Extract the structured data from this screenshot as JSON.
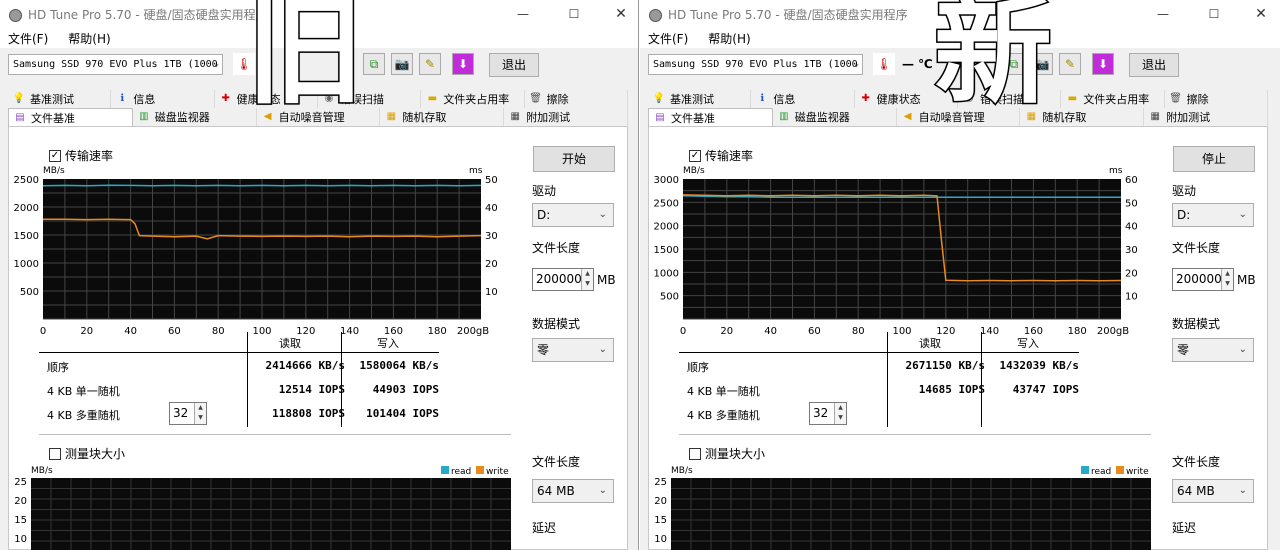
{
  "overlay": {
    "left_char": "旧",
    "right_char": "新"
  },
  "windows": [
    {
      "id": "left",
      "title": "HD Tune Pro 5.70 - 硬盘/固态硬盘实用程序",
      "menu": {
        "file": "文件(F)",
        "help": "帮助(H)"
      },
      "drive": "Samsung SSD 970 EVO Plus 1TB (1000",
      "exit_label": "退出",
      "temp_text": "",
      "tabs_row1": [
        "基准测试",
        "信息",
        "健康状态",
        "错误扫描",
        "文件夹占用率",
        "擦除"
      ],
      "tabs_row2": [
        "文件基准",
        "磁盘监视器",
        "自动噪音管理",
        "随机存取",
        "附加测试"
      ],
      "active_tab": "文件基准",
      "transfer_checkbox": "传输速率",
      "start_button": "开始",
      "drive_label": "驱动",
      "drive_value": "D:",
      "file_length_label": "文件长度",
      "file_length_value": "200000",
      "file_length_unit": "MB",
      "data_mode_label": "数据模式",
      "data_mode_value": "零",
      "results": {
        "read_header": "读取",
        "write_header": "写入",
        "seq_label": "顺序",
        "seq_read": "2414666 KB/s",
        "seq_write": "1580064 KB/s",
        "rand1_label": "4 KB 单一随机",
        "rand1_read": "12514 IOPS",
        "rand1_write": "44903 IOPS",
        "randm_label": "4 KB 多重随机",
        "randm_read": "118808 IOPS",
        "randm_write": "101404 IOPS",
        "queue_depth": "32"
      },
      "block_checkbox": "测量块大小",
      "block_file_length_label": "文件长度",
      "block_file_length_value": "64 MB",
      "latency_label": "延迟",
      "block_chart": {
        "ylabel": "MB/s",
        "ticks": [
          "25",
          "20",
          "15",
          "10"
        ],
        "legend_read": "read",
        "legend_write": "write"
      },
      "chart_data": {
        "type": "line",
        "ylabel_left": "MB/s",
        "ylabel_right": "ms",
        "ylim_left": [
          0,
          2500
        ],
        "yticks_left": [
          "2500",
          "2000",
          "1500",
          "1000",
          "500"
        ],
        "ylim_right": [
          0,
          50
        ],
        "yticks_right": [
          "50",
          "40",
          "30",
          "20",
          "10"
        ],
        "xlim": [
          0,
          200
        ],
        "xticks": [
          "0",
          "20",
          "40",
          "60",
          "80",
          "100",
          "120",
          "140",
          "160",
          "180",
          "200gB"
        ],
        "series": [
          {
            "color": "#2aa8c8",
            "x": [
              0,
              10,
              20,
              30,
              40,
              50,
              60,
              70,
              80,
              90,
              100,
              110,
              120,
              130,
              140,
              150,
              160,
              170,
              180,
              190,
              200
            ],
            "y": [
              2380,
              2385,
              2380,
              2390,
              2385,
              2380,
              2385,
              2380,
              2385,
              2380,
              2385,
              2380,
              2385,
              2380,
              2385,
              2380,
              2385,
              2380,
              2385,
              2380,
              2385
            ]
          },
          {
            "color": "#e88a1e",
            "x": [
              0,
              10,
              20,
              30,
              40,
              42,
              44,
              50,
              60,
              70,
              75,
              80,
              90,
              100,
              110,
              120,
              130,
              140,
              150,
              160,
              170,
              180,
              190,
              200
            ],
            "y": [
              1780,
              1780,
              1775,
              1780,
              1775,
              1700,
              1490,
              1480,
              1470,
              1480,
              1430,
              1490,
              1480,
              1475,
              1480,
              1475,
              1480,
              1470,
              1480,
              1475,
              1480,
              1470,
              1480,
              1490
            ]
          }
        ]
      }
    },
    {
      "id": "right",
      "title": "HD Tune Pro 5.70 - 硬盘/固态硬盘实用程序",
      "menu": {
        "file": "文件(F)",
        "help": "帮助(H)"
      },
      "drive": "Samsung SSD 970 EVO Plus 1TB (1000",
      "exit_label": "退出",
      "temp_text": "— ℃",
      "tabs_row1": [
        "基准测试",
        "信息",
        "健康状态",
        "错误扫描",
        "文件夹占用率",
        "擦除"
      ],
      "tabs_row2": [
        "文件基准",
        "磁盘监视器",
        "自动噪音管理",
        "随机存取",
        "附加测试"
      ],
      "active_tab": "文件基准",
      "transfer_checkbox": "传输速率",
      "start_button": "停止",
      "drive_label": "驱动",
      "drive_value": "D:",
      "file_length_label": "文件长度",
      "file_length_value": "200000",
      "file_length_unit": "MB",
      "data_mode_label": "数据模式",
      "data_mode_value": "零",
      "results": {
        "read_header": "读取",
        "write_header": "写入",
        "seq_label": "顺序",
        "seq_read": "2671150 KB/s",
        "seq_write": "1432039 KB/s",
        "rand1_label": "4 KB 单一随机",
        "rand1_read": "14685 IOPS",
        "rand1_write": "43747 IOPS",
        "randm_label": "4 KB 多重随机",
        "randm_read": "",
        "randm_write": "",
        "queue_depth": "32"
      },
      "block_checkbox": "测量块大小",
      "block_file_length_label": "文件长度",
      "block_file_length_value": "64 MB",
      "latency_label": "延迟",
      "block_chart": {
        "ylabel": "MB/s",
        "ticks": [
          "25",
          "20",
          "15",
          "10"
        ],
        "legend_read": "read",
        "legend_write": "write"
      },
      "chart_data": {
        "type": "line",
        "ylabel_left": "MB/s",
        "ylabel_right": "ms",
        "ylim_left": [
          0,
          3000
        ],
        "yticks_left": [
          "3000",
          "2500",
          "2000",
          "1500",
          "1000",
          "500"
        ],
        "ylim_right": [
          0,
          60
        ],
        "yticks_right": [
          "60",
          "50",
          "40",
          "30",
          "20",
          "10"
        ],
        "xlim": [
          0,
          200
        ],
        "xticks": [
          "0",
          "20",
          "40",
          "60",
          "80",
          "100",
          "120",
          "140",
          "160",
          "180",
          "200gB"
        ],
        "series": [
          {
            "color": "#2aa8c8",
            "x": [
              0,
              10,
              20,
              30,
              40,
              50,
              60,
              70,
              80,
              90,
              100,
              110,
              120,
              130,
              140,
              150,
              160,
              170,
              180,
              190,
              200
            ],
            "y": [
              2640,
              2630,
              2620,
              2620,
              2610,
              2610,
              2610,
              2610,
              2610,
              2610,
              2610,
              2610,
              2610,
              2610,
              2610,
              2610,
              2610,
              2610,
              2610,
              2610,
              2610
            ]
          },
          {
            "color": "#e88a1e",
            "x": [
              0,
              10,
              20,
              30,
              40,
              50,
              60,
              70,
              80,
              90,
              100,
              110,
              116,
              118,
              120,
              130,
              140,
              150,
              160,
              170,
              180,
              190,
              200
            ],
            "y": [
              2660,
              2650,
              2640,
              2650,
              2640,
              2650,
              2640,
              2650,
              2640,
              2650,
              2640,
              2650,
              2640,
              1700,
              830,
              820,
              825,
              820,
              825,
              820,
              825,
              820,
              825
            ]
          }
        ]
      }
    }
  ]
}
